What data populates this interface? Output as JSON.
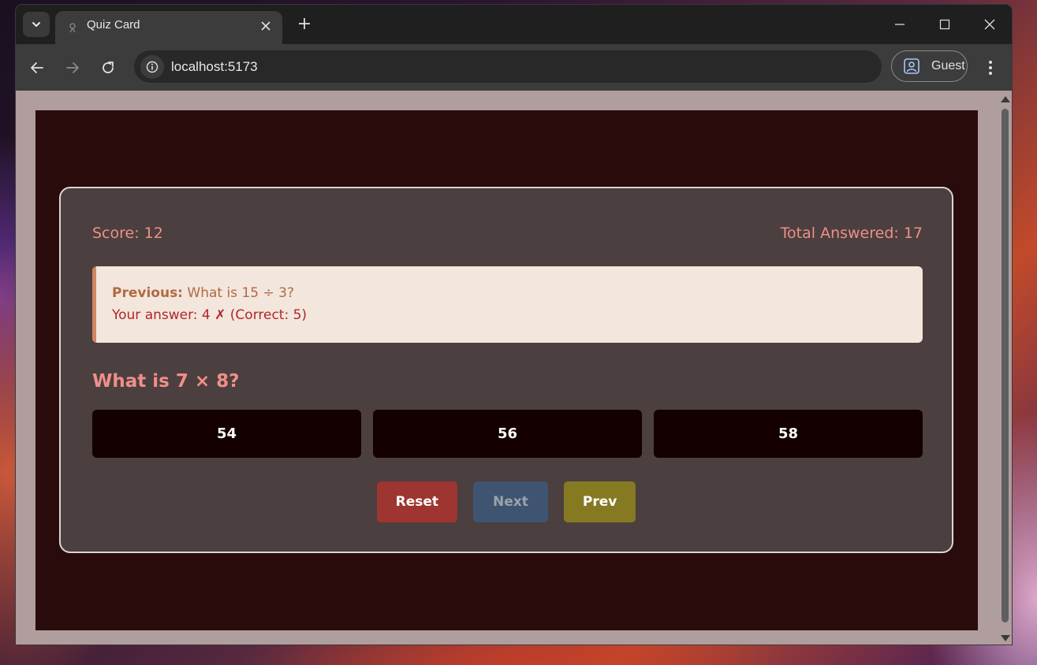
{
  "browser": {
    "tab_title": "Quiz Card",
    "url": "localhost:5173",
    "profile_label": "Guest"
  },
  "quiz": {
    "score_text": "Score: 12",
    "total_text": "Total Answered: 17",
    "feedback": {
      "label": "Previous:",
      "previous_question": "What is 15 ÷ 3?",
      "answer_line": "Your answer: 4 ✗ (Correct: 5)"
    },
    "question": "What is 7 × 8?",
    "options": [
      "54",
      "56",
      "58"
    ],
    "controls": {
      "reset_label": "Reset",
      "next_label": "Next",
      "prev_label": "Prev"
    }
  },
  "colors": {
    "page_background": "#2a0b0b",
    "card_background": "#4b3f3f",
    "accent_text": "#ef8f88",
    "reset_button": "#9e3530",
    "next_button": "#3f5470",
    "prev_button": "#857a22",
    "feedback_wrong": "#b3242a"
  }
}
